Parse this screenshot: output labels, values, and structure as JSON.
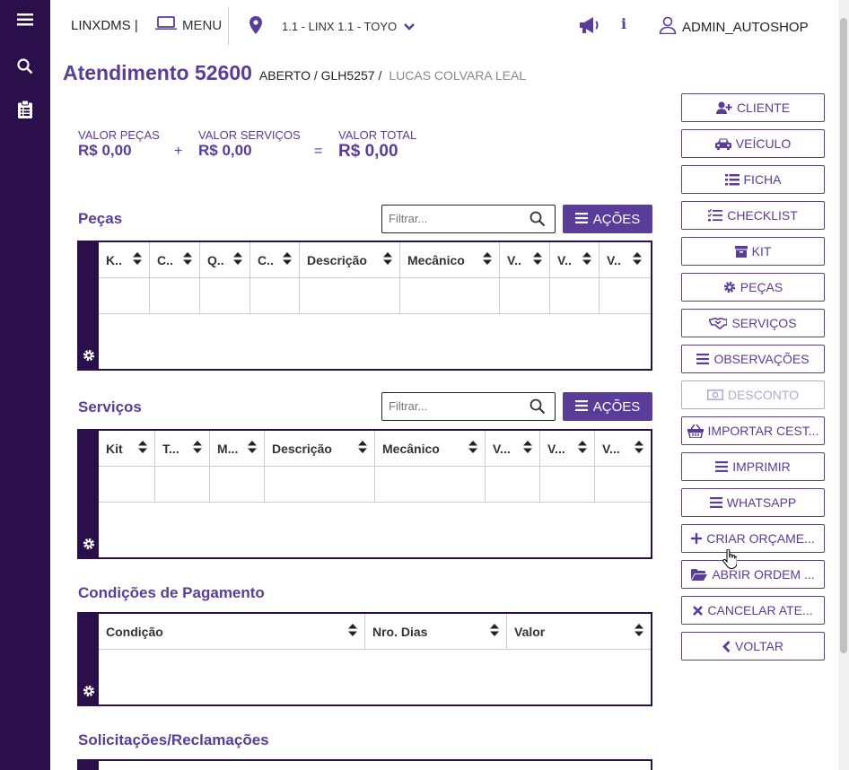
{
  "topbar": {
    "brand": "LINXDMS |",
    "menu_label": "MENU",
    "location": "1.1 - LINX 1.1 - TOYO",
    "user": "ADMIN_AUTOSHOP"
  },
  "header": {
    "title": "Atendimento 52600",
    "status": "ABERTO / GLH5257 /",
    "client": "LUCAS COLVARA LEAL"
  },
  "totals": {
    "parts_label": "VALOR PEÇAS",
    "parts_value": "R$ 0,00",
    "plus": "+",
    "services_label": "VALOR SERVIÇOS",
    "services_value": "R$ 0,00",
    "equals": "=",
    "total_label": "VALOR TOTAL",
    "total_value": "R$ 0,00"
  },
  "pecas": {
    "title": "Peças",
    "filter_placeholder": "Filtrar...",
    "actions_label": "AÇÕES",
    "columns": [
      "K..",
      "C..",
      "Q..",
      "C..",
      "Descrição",
      "Mecânico",
      "V..",
      "V..",
      "V.."
    ]
  },
  "servicos": {
    "title": "Serviços",
    "filter_placeholder": "Filtrar...",
    "actions_label": "AÇÕES",
    "columns": [
      "Kit",
      "T...",
      "M...",
      "Descrição",
      "Mecânico",
      "V...",
      "V...",
      "V..."
    ]
  },
  "pagamento": {
    "title": "Condições de Pagamento",
    "columns": [
      "Condição",
      "Nro. Dias",
      "Valor"
    ]
  },
  "solicitacoes": {
    "title": "Solicitações/Reclamações"
  },
  "side_buttons": [
    {
      "label": "CLIENTE",
      "icon": "user-plus-icon"
    },
    {
      "label": "VEÍCULO",
      "icon": "car-icon"
    },
    {
      "label": "FICHA",
      "icon": "list-icon"
    },
    {
      "label": "CHECKLIST",
      "icon": "checklist-icon"
    },
    {
      "label": "KIT",
      "icon": "archive-icon"
    },
    {
      "label": "PEÇAS",
      "icon": "cog-icon"
    },
    {
      "label": "SERVIÇOS",
      "icon": "handshake-icon"
    },
    {
      "label": "OBSERVAÇÕES",
      "icon": "bars-icon"
    },
    {
      "label": "DESCONTO",
      "icon": "money-icon",
      "disabled": true
    },
    {
      "label": "IMPORTAR CEST...",
      "icon": "basket-icon"
    },
    {
      "label": "IMPRIMIR",
      "icon": "bars-icon"
    },
    {
      "label": "WHATSAPP",
      "icon": "bars-icon"
    },
    {
      "label": "CRIAR ORÇAME...",
      "icon": "plus-icon"
    },
    {
      "label": "ABRIR ORDEM ...",
      "icon": "folder-open-icon"
    },
    {
      "label": "CANCELAR ATE...",
      "icon": "times-icon"
    },
    {
      "label": "VOLTAR",
      "icon": "chevron-left-icon"
    }
  ],
  "colors": {
    "primary": "#5a3c99",
    "sidebar": "#2a0f4a",
    "disabled": "#b6a9d0"
  }
}
